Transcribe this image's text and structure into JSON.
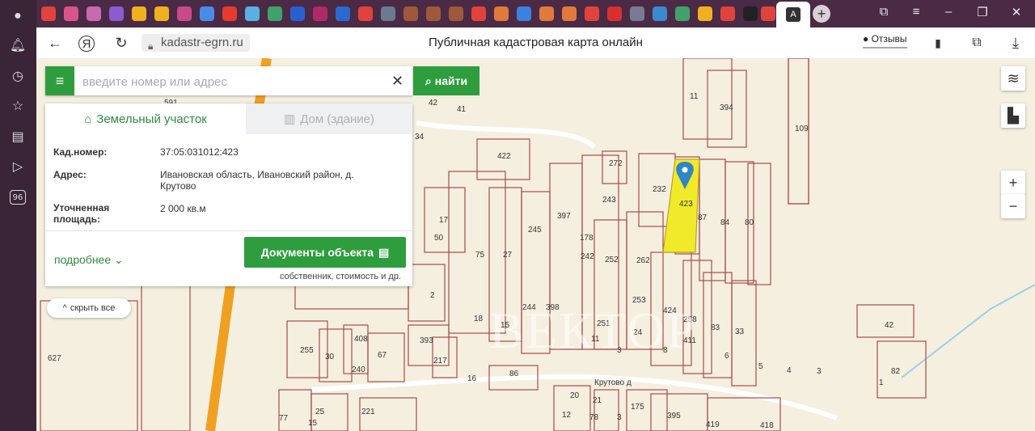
{
  "browser": {
    "url": "kadastr-egrn.ru",
    "page_title": "Публичная кадастровая карта онлайн",
    "reviews_label": "Отзывы",
    "sidebar_badge": "96"
  },
  "search": {
    "placeholder": "введите номер или адрес",
    "find_label": "найти"
  },
  "panel": {
    "tab_land": "Земельный участок",
    "tab_house": "Дом (здание)",
    "fields": [
      {
        "label": "Кад.номер:",
        "value": "37:05:031012:423"
      },
      {
        "label": "Адрес:",
        "value": "Ивановская область, Ивановский район, д. Крутово"
      },
      {
        "label": "Уточненная площадь:",
        "value": "2 000 кв.м"
      }
    ],
    "more_label": "подробнее",
    "docs_label": "Документы объекта",
    "docs_sub": "собственник, стоимость и др."
  },
  "map": {
    "hide_all_label": "скрыть все",
    "street_label": "Крутово д",
    "watermark": "ВЕКТОР",
    "plot_numbers": [
      "591",
      "42",
      "41",
      "34",
      "422",
      "272",
      "232",
      "423",
      "87",
      "84",
      "80",
      "11",
      "394",
      "109",
      "17",
      "50",
      "75",
      "27",
      "245",
      "397",
      "178",
      "243",
      "242",
      "252",
      "262",
      "253",
      "424",
      "258",
      "411",
      "83",
      "33",
      "2",
      "393",
      "18",
      "15",
      "244",
      "398",
      "251",
      "24",
      "11",
      "8",
      "3",
      "6",
      "217",
      "16",
      "86",
      "5",
      "4",
      "3",
      "20",
      "21",
      "175",
      "395",
      "419",
      "418",
      "1",
      "42",
      "82",
      "627",
      "255",
      "30",
      "408",
      "67",
      "240",
      "77",
      "15",
      "25",
      "221",
      "12",
      "78",
      "3"
    ],
    "zoom_in": "+",
    "zoom_out": "−"
  }
}
